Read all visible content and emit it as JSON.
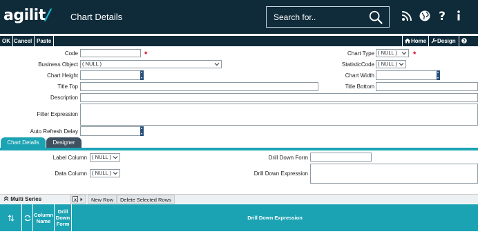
{
  "app": {
    "logo_text": "agilit",
    "logo_slash": "/",
    "page_title": "Chart Details"
  },
  "search": {
    "placeholder": "Search for.."
  },
  "header_icons": [
    "rss-icon",
    "globe-icon",
    "help-icon",
    "info-icon"
  ],
  "toolbar": {
    "ok_label": "OK",
    "cancel_label": "Cancel",
    "paste_label": "Paste",
    "home_label": "Home",
    "design_label": "Design",
    "help_label": "Help"
  },
  "form": {
    "code_label": "Code",
    "code_value": "",
    "chart_type_label": "Chart Type",
    "chart_type_value": "( NULL )",
    "business_object_label": "Business Object",
    "business_object_value": "( NULL )",
    "statistic_code_label": "StatisticCode",
    "statistic_code_value": "( NULL )",
    "chart_height_label": "Chart Height",
    "chart_height_value": "",
    "chart_width_label": "Chart Width",
    "chart_width_value": "",
    "title_top_label": "Title Top",
    "title_top_value": "",
    "title_bottom_label": "Title Bottom",
    "title_bottom_value": "",
    "description_label": "Description",
    "description_value": "",
    "filter_expression_label": "Filter Expression",
    "filter_expression_value": "",
    "auto_refresh_delay_label": "Auto Refresh Delay",
    "auto_refresh_delay_value": ""
  },
  "tabs": [
    {
      "label": "Chart Details",
      "active": true
    },
    {
      "label": "Designer",
      "active": false
    }
  ],
  "details": {
    "label_column_label": "Label Column",
    "label_column_value": "( NULL )",
    "data_column_label": "Data Column",
    "data_column_value": "( NULL )",
    "drill_down_form_label": "Drill Down Form",
    "drill_down_form_value": "",
    "drill_down_expression_label": "Drill Down Expression",
    "drill_down_expression_value": ""
  },
  "multi_series": {
    "title": "Multi Series",
    "new_row_label": "New Row",
    "delete_selected_label": "Delete Selected Rows",
    "columns": [
      "Column Name",
      "Drill Down Form",
      "Drill Down Expression"
    ]
  },
  "colors": {
    "header_bg": "#0f2b3a",
    "accent": "#1ba3b4",
    "required": "#d0021b"
  }
}
